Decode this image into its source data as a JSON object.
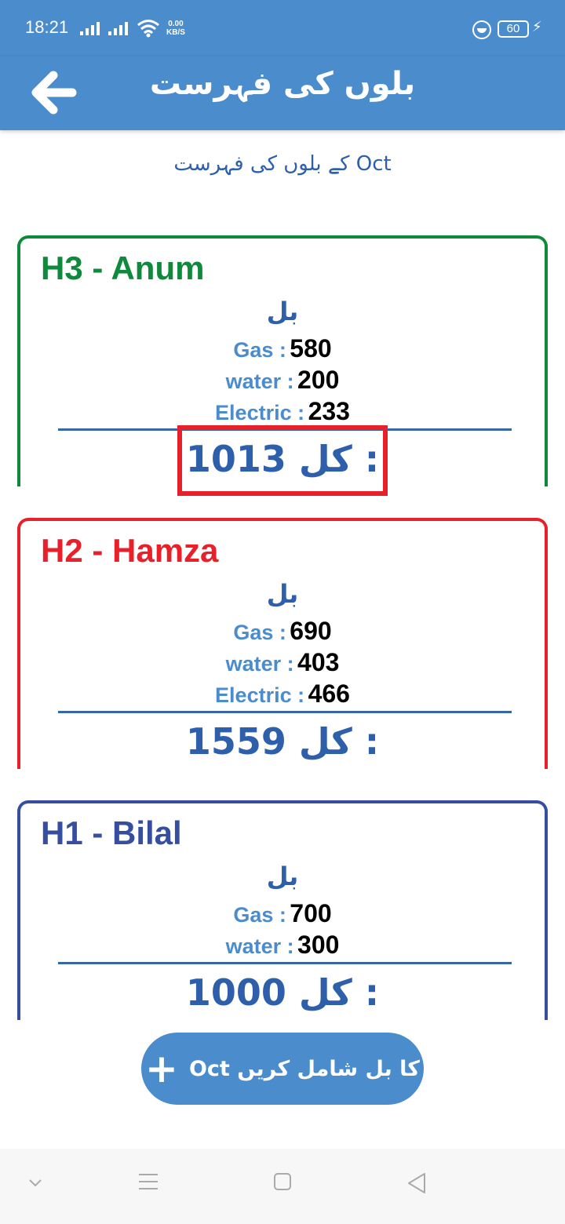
{
  "status": {
    "time": "18:21",
    "net_speed_value": "0.00",
    "net_speed_unit": "KB/S",
    "battery": "60"
  },
  "appbar": {
    "title": "بلوں کی فہرست",
    "back_icon": "arrow-left-icon"
  },
  "subtitle": "کے بلوں کی فہرست Oct",
  "cards": [
    {
      "name": "H3 - Anum",
      "color": "#0f8a3c",
      "bill_header": "بل",
      "gas_label": "Gas :",
      "gas": "580",
      "water_label": "water :",
      "water": "200",
      "electric_label": "Electric :",
      "electric": "233",
      "total_label": "کل :",
      "total": "1013"
    },
    {
      "name": "H2 - Hamza",
      "color": "#e8202a",
      "bill_header": "بل",
      "gas_label": "Gas :",
      "gas": "690",
      "water_label": "water :",
      "water": "403",
      "electric_label": "Electric :",
      "electric": "466",
      "total_label": "کل :",
      "total": "1559"
    },
    {
      "name": "H1 - Bilal",
      "color": "#354ea0",
      "bill_header": "بل",
      "gas_label": "Gas :",
      "gas": "700",
      "water_label": "water :",
      "water": "300",
      "total_label": "کل :",
      "total": "1000"
    }
  ],
  "add_button": {
    "label": "کا بل شامل کریں Oct",
    "icon": "plus-icon"
  },
  "colors": {
    "primary": "#4b8ccc",
    "text_blue": "#2e5faa",
    "highlight": "#e8202a"
  }
}
